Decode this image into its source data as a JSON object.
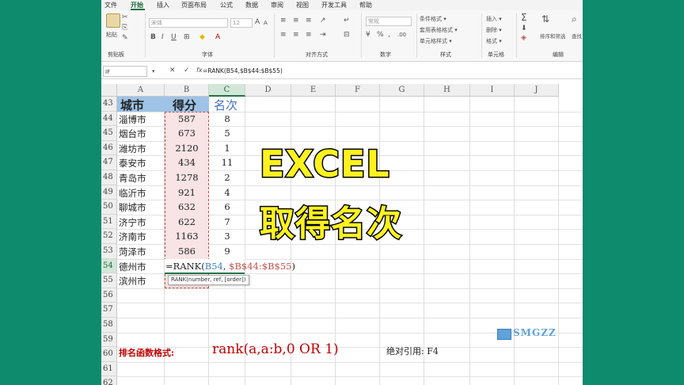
{
  "menu": [
    "文件",
    "开始",
    "插入",
    "页面布局",
    "公式",
    "数据",
    "审阅",
    "视图",
    "开发工具",
    "帮助"
  ],
  "ribbon": {
    "clipboard_label": "剪贴板",
    "paste": "粘贴",
    "font_label": "字体",
    "font_name": "宋体",
    "font_size": "12",
    "align_label": "对齐方式",
    "number_label": "数字",
    "number_format": "常规",
    "style_label": "样式",
    "style_items": [
      "条件格式 ▾",
      "套用表格格式 ▾",
      "单元格样式 ▾"
    ],
    "cells_label": "单元格",
    "cells_items": [
      "插入 ▾",
      "删除 ▾",
      "格式 ▾"
    ],
    "edit_label": "编辑",
    "edit_items": [
      "排序和筛选",
      "查找"
    ]
  },
  "formula_bar": {
    "name_box": "IF",
    "formula": "=RANK(B54,$B$44:$B$55)"
  },
  "columns": [
    "A",
    "B",
    "C",
    "D",
    "E",
    "F",
    "G",
    "H",
    "I",
    "J"
  ],
  "rows": [
    "43",
    "44",
    "45",
    "46",
    "47",
    "48",
    "49",
    "50",
    "51",
    "52",
    "53",
    "54",
    "55",
    "56",
    "57",
    "58",
    "59",
    "60",
    "61",
    "62"
  ],
  "table": {
    "headers": [
      "城市",
      "得分",
      "名次"
    ],
    "data": [
      {
        "city": "淄博市",
        "score": "587",
        "rank": "8"
      },
      {
        "city": "烟台市",
        "score": "673",
        "rank": "5"
      },
      {
        "city": "潍坊市",
        "score": "2120",
        "rank": "1"
      },
      {
        "city": "泰安市",
        "score": "434",
        "rank": "11"
      },
      {
        "city": "青岛市",
        "score": "1278",
        "rank": "2"
      },
      {
        "city": "临沂市",
        "score": "921",
        "rank": "4"
      },
      {
        "city": "聊城市",
        "score": "632",
        "rank": "6"
      },
      {
        "city": "济宁市",
        "score": "622",
        "rank": "7"
      },
      {
        "city": "济南市",
        "score": "1163",
        "rank": "3"
      },
      {
        "city": "菏泽市",
        "score": "586",
        "rank": "9"
      }
    ],
    "row54_city": "德州市",
    "row55_city": "滨州市",
    "editing": {
      "prefix": "=RANK(",
      "arg1": "B54",
      "sep": ", ",
      "arg2": "$B$44:$B$55",
      "suffix": ")"
    },
    "tooltip": "RANK(number, ref, [order])"
  },
  "overlay": {
    "line1": "EXCEL",
    "line2": "取得名次"
  },
  "note": {
    "label": "排名函数格式:",
    "syntax": "rank(a,a:b,0 OR 1)",
    "abs_ref": "绝对引用: F4"
  },
  "watermark": "SMGZZ",
  "colors": {
    "background": "#0e8a6c",
    "header_fill": "#9dc3e6",
    "score_fill": "#f8e4e4",
    "overlay_text": "#fff21e",
    "note_red": "#c00000",
    "excel_green": "#217346"
  }
}
